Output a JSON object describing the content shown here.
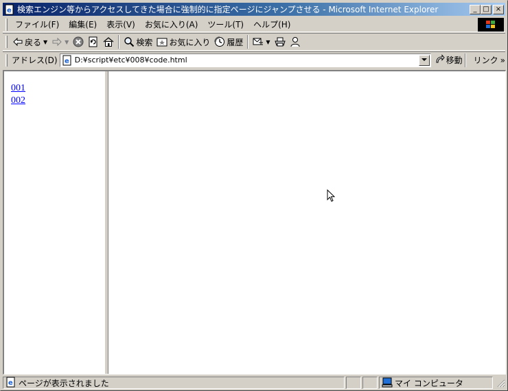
{
  "window": {
    "title": "検索エンジン等からアクセスしてきた場合に強制的に指定ページにジャンプさせる - Microsoft Internet Explorer",
    "minimize_glyph": "_",
    "maximize_glyph": "□",
    "close_glyph": "×"
  },
  "menu": {
    "items": [
      "ファイル(F)",
      "編集(E)",
      "表示(V)",
      "お気に入り(A)",
      "ツール(T)",
      "ヘルプ(H)"
    ]
  },
  "toolbar": {
    "back_label": "戻る",
    "search_label": "検索",
    "favorites_label": "お気に入り",
    "history_label": "履歴"
  },
  "address": {
    "label": "アドレス(D)",
    "value": "D:¥script¥etc¥008¥code.html",
    "go_label": "移動",
    "links_label": "リンク"
  },
  "frames": {
    "left_links": [
      "001",
      "002"
    ]
  },
  "status": {
    "message": "ページが表示されました",
    "zone": "マイ コンピュータ"
  },
  "colors": {
    "titlebar_start": "#0a246a",
    "titlebar_end": "#a6caf0",
    "chrome": "#d4d0c8",
    "link": "#0000ff"
  }
}
